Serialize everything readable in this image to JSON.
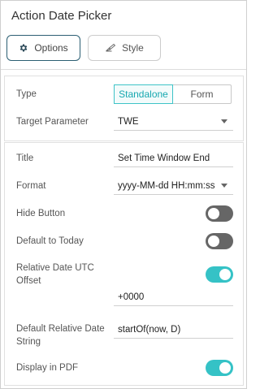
{
  "panel": {
    "title": "Action Date Picker"
  },
  "tabs": {
    "options_label": "Options",
    "style_label": "Style"
  },
  "type": {
    "label": "Type",
    "options": [
      "Standalone",
      "Form"
    ],
    "selected": "Standalone"
  },
  "target_parameter": {
    "label": "Target Parameter",
    "value": "TWE"
  },
  "title_field": {
    "label": "Title",
    "value": "Set Time Window End"
  },
  "format": {
    "label": "Format",
    "value": "yyyy-MM-dd HH:mm:ss"
  },
  "hide_button": {
    "label": "Hide Button",
    "enabled": false
  },
  "default_to_today": {
    "label": "Default to Today",
    "enabled": false
  },
  "relative_date_utc_offset": {
    "label": "Relative Date UTC Offset",
    "enabled": true,
    "value": "+0000"
  },
  "default_relative_date_string": {
    "label": "Default Relative Date String",
    "value": "startOf(now, D)"
  },
  "display_in_pdf": {
    "label": "Display in PDF",
    "enabled": true
  },
  "colors": {
    "accent": "#35c2c6",
    "toggle_off": "#666666",
    "options_border": "#2c5f73"
  },
  "icons": {
    "options": "gear-icon",
    "style": "brush-icon",
    "dropdown": "caret-down-icon"
  }
}
